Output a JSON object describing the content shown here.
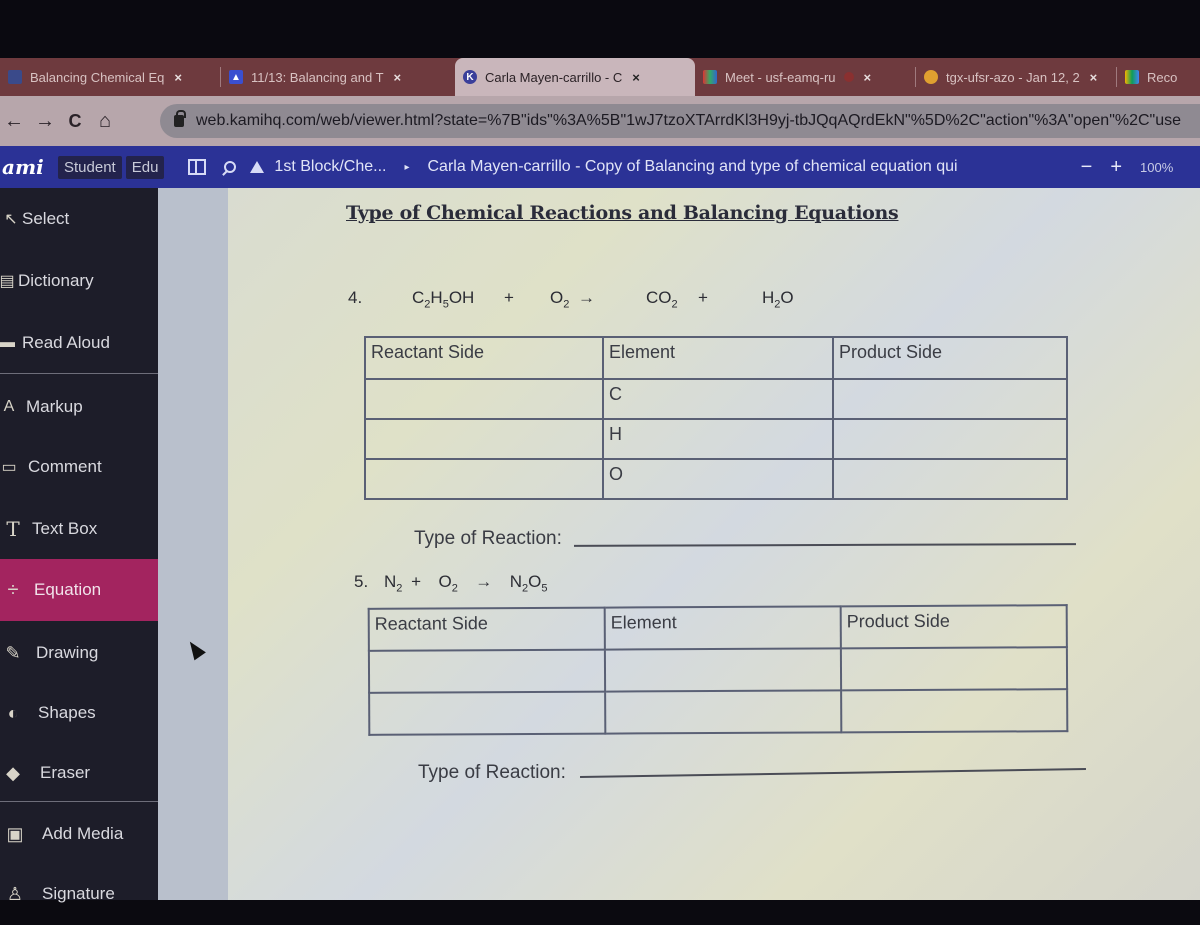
{
  "browser": {
    "tabs": [
      {
        "label": "Balancing Chemical Eq",
        "icon": "kami-doc-icon",
        "active": false
      },
      {
        "label": "11/13: Balancing and T",
        "icon": "classroom-icon",
        "active": false
      },
      {
        "label": "Carla Mayen-carrillo - C",
        "icon": "kami-k-icon",
        "active": true
      },
      {
        "label": "Meet - usf-eamq-ru",
        "icon": "meet-icon",
        "active": false
      },
      {
        "label": "tgx-ufsr-azo - Jan 12, 2",
        "icon": "meet-recording-icon",
        "active": false
      },
      {
        "label": "Reco",
        "icon": "drive-icon",
        "active": false
      }
    ],
    "close_glyph": "×",
    "nav": {
      "back": "←",
      "forward": "→",
      "reload": "C",
      "home": "⌂"
    },
    "url": "web.kamihq.com/web/viewer.html?state=%7B\"ids\"%3A%5B\"1wJ7tzoXTArrdKl3H9yj-tbJQqAQrdEkN\"%5D%2C\"action\"%3A\"open\"%2C\"use"
  },
  "kami": {
    "logo": "ami",
    "badges": [
      "Student",
      "Edu"
    ],
    "breadcrumb": {
      "folder": "1st Block/Che...",
      "separator": "▸",
      "document": "Carla Mayen-carrillo - Copy of Balancing and type of chemical equation qui"
    },
    "zoom": {
      "minus": "−",
      "plus": "+",
      "value": "100%"
    }
  },
  "sidebar": {
    "items": [
      {
        "label": "Select",
        "icon": "↖"
      },
      {
        "label": "Dictionary",
        "icon": "▤"
      },
      {
        "label": "Read Aloud",
        "icon": "▬"
      },
      {
        "label": "Markup",
        "icon": "A"
      },
      {
        "label": "Comment",
        "icon": "▭"
      },
      {
        "label": "Text Box",
        "icon": "T"
      },
      {
        "label": "Equation",
        "icon": "÷",
        "active": true
      },
      {
        "label": "Drawing",
        "icon": "✎"
      },
      {
        "label": "Shapes",
        "icon": "◐"
      },
      {
        "label": "Eraser",
        "icon": "◆"
      },
      {
        "label": "Add Media",
        "icon": "▣"
      },
      {
        "label": "Signature",
        "icon": "♙"
      }
    ]
  },
  "document": {
    "title": "Type of Chemical Reactions and Balancing Equations",
    "problem4": {
      "number": "4.",
      "reactant1": "C2H5OH",
      "plus1": "+",
      "reactant2": "O2",
      "arrow": "→",
      "product1": "CO2",
      "plus2": "+",
      "product2": "H2O",
      "table": {
        "headers": [
          "Reactant Side",
          "Element",
          "Product Side"
        ],
        "elements": [
          "C",
          "H",
          "O"
        ]
      },
      "type_label": "Type of Reaction:"
    },
    "problem5": {
      "number": "5.",
      "equation": "N2 + O2 → N2O5",
      "table": {
        "headers": [
          "Reactant Side",
          "Element",
          "Product Side"
        ],
        "elements": [
          "",
          ""
        ]
      },
      "type_label": "Type of Reaction:"
    }
  }
}
